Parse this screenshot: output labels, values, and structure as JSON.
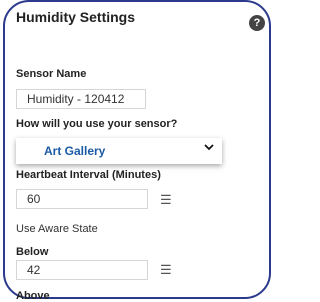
{
  "panel": {
    "title": "Humidity Settings",
    "help_glyph": "?"
  },
  "fields": {
    "sensor_name_label": "Sensor Name",
    "sensor_name_value": "Humidity - 120412",
    "usage_label": "How will you use your sensor?",
    "usage_value": "Art Gallery",
    "heartbeat_label": "Heartbeat Interval (Minutes)",
    "heartbeat_value": "60",
    "aware_state_label": "Use Aware State",
    "below_label": "Below",
    "below_value": "42",
    "above_label": "Above"
  },
  "icons": {
    "list": "list-icon",
    "help": "question-circle-icon",
    "dropdown": "chevron-down-icon"
  },
  "colors": {
    "accent_blue": "#1b5aa6",
    "frame_blue": "#2b3a8c"
  }
}
